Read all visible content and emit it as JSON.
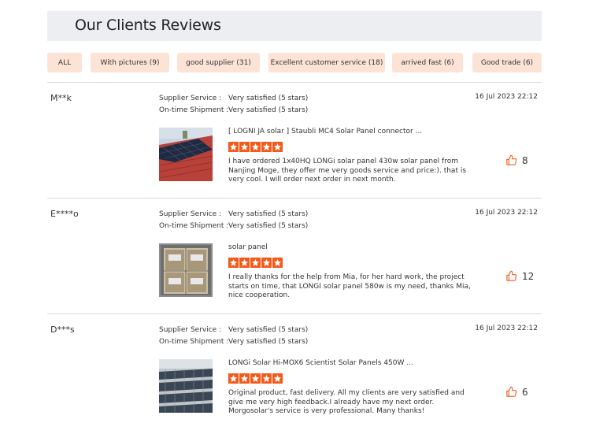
{
  "header": {
    "title": "Our Clients Reviews"
  },
  "filters": [
    {
      "label": "ALL"
    },
    {
      "label": "With pictures (9)"
    },
    {
      "label": "good supplier (31)"
    },
    {
      "label": "Excellent customer service (18)"
    },
    {
      "label": "arrived fast (6)"
    },
    {
      "label": "Good trade (6)"
    }
  ],
  "labels": {
    "supplier_service": "Supplier Service :",
    "ontime_shipment": "On-time Shipment :"
  },
  "colors": {
    "accent": "#f25a1c",
    "pill_bg": "#fde3d6",
    "header_bg": "#eceef2"
  },
  "reviews": [
    {
      "reviewer": "M**k",
      "supplier_service": "Very satisfied (5 stars)",
      "ontime_shipment": "Very satisfied (5 stars)",
      "date": "16 Jul 2023 22:12",
      "product": "[ LOGNI JA solar ] Staubli MC4 Solar Panel connector ...",
      "rating": 5,
      "comment": "I have ordered 1x40HQ LONGi solar panel 430w solar panel from Nanjing Moge, they offer me very goods service and price:). that is very cool. I will order next order in next month.",
      "likes": "8",
      "image": "solar-panels-on-red-roof"
    },
    {
      "reviewer": "E****o",
      "supplier_service": "Very satisfied (5 stars)",
      "ontime_shipment": "Very satisfied (5 stars)",
      "date": "16 Jul 2023 22:12",
      "product": "solar panel",
      "rating": 5,
      "comment": "I really thanks for the help from Mia, for her hard work, the project starts on time, that LONGI solar panel 580w is my need, thanks Mia, nice cooperation.",
      "likes": "12",
      "image": "container-loaded-with-panels"
    },
    {
      "reviewer": "D***s",
      "supplier_service": "Very satisfied (5 stars)",
      "ontime_shipment": "Very satisfied (5 stars)",
      "date": "16 Jul 2023 22:12",
      "product": "LONGi Solar Hi-MOX6 Scientist Solar Panels 450W ...",
      "rating": 5,
      "comment": "Original product, fast delivery. All my clients are very satisfied and give me very high feedback.I already have my next order. Morgosolar's service is very professional. Many thanks!",
      "likes": "6",
      "image": "solar-farm-array"
    }
  ]
}
